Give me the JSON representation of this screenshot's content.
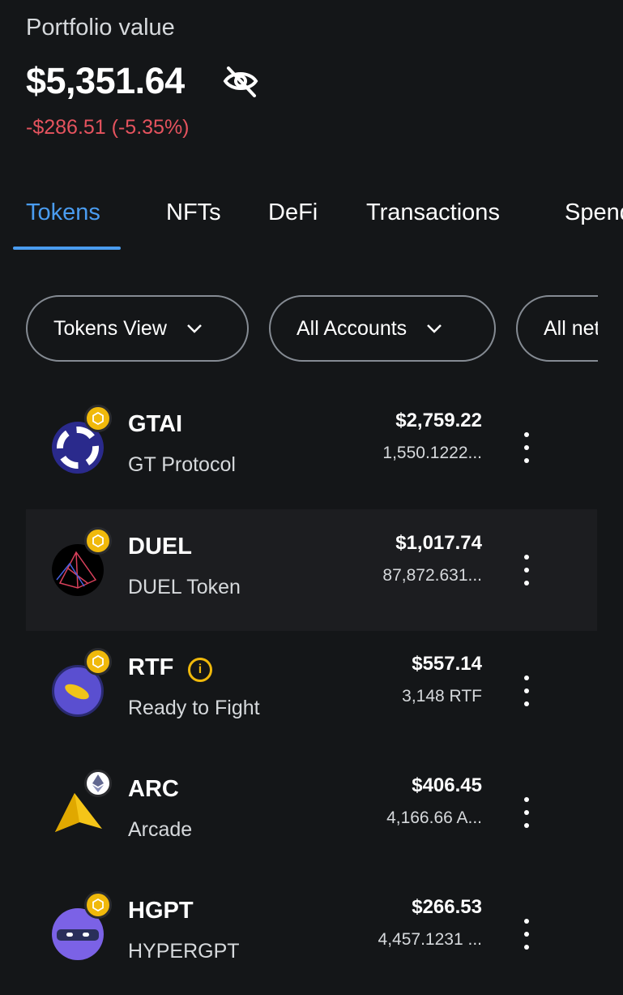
{
  "portfolio": {
    "label": "Portfolio value",
    "value": "$5,351.64",
    "change": "-$286.51  (-5.35%)",
    "hide_icon": "eye-off-icon"
  },
  "tabs": [
    {
      "label": "Tokens",
      "active": true
    },
    {
      "label": "NFTs"
    },
    {
      "label": "DeFi"
    },
    {
      "label": "Transactions"
    },
    {
      "label": "Spending"
    }
  ],
  "filters": [
    {
      "label": "Tokens View"
    },
    {
      "label": "All Accounts"
    },
    {
      "label": "All networks"
    }
  ],
  "colors": {
    "accent": "#4a9cf0",
    "negative": "#e5535e",
    "background": "#141618",
    "bnb": "#f0b90b"
  },
  "tokens": [
    {
      "symbol": "GTAI",
      "name": "GT Protocol",
      "fiat": "$2,759.22",
      "amount": "1,550.1222...",
      "network": "bnb"
    },
    {
      "symbol": "DUEL",
      "name": "DUEL Token",
      "fiat": "$1,017.74",
      "amount": "87,872.631...",
      "network": "bnb"
    },
    {
      "symbol": "RTF",
      "name": "Ready to Fight",
      "fiat": "$557.14",
      "amount": "3,148 RTF",
      "network": "bnb",
      "info": "i"
    },
    {
      "symbol": "ARC",
      "name": "Arcade",
      "fiat": "$406.45",
      "amount": "4,166.66 A...",
      "network": "ethereum"
    },
    {
      "symbol": "HGPT",
      "name": "HYPERGPT",
      "fiat": "$266.53",
      "amount": "4,457.1231 ...",
      "network": "bnb"
    }
  ]
}
